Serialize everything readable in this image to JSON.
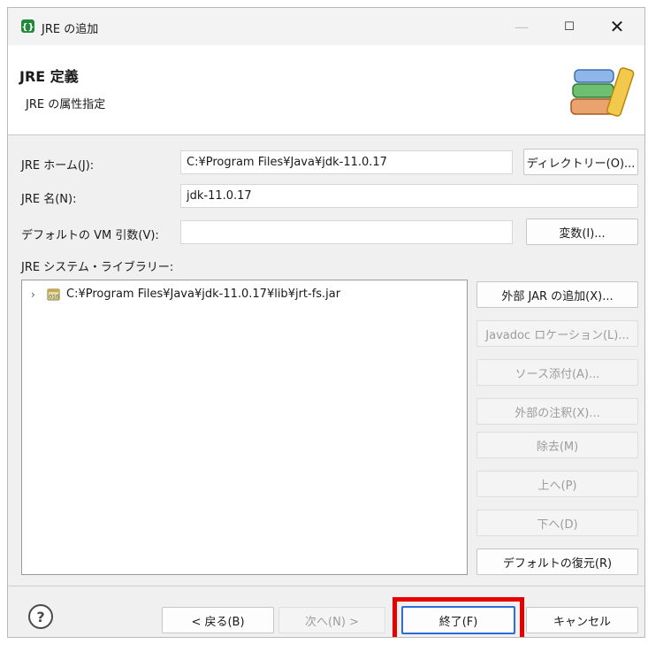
{
  "window": {
    "title": "JRE の追加",
    "min_glyph": "—",
    "max_glyph": "☐",
    "close_glyph": "✕"
  },
  "header": {
    "title": "JRE 定義",
    "subtitle": "JRE の属性指定"
  },
  "form": {
    "jre_home_label": "JRE ホーム(J):",
    "jre_home_value": "C:¥Program Files¥Java¥jdk-11.0.17",
    "directory_button": "ディレクトリー(O)...",
    "jre_name_label": "JRE 名(N):",
    "jre_name_value": "jdk-11.0.17",
    "vm_args_label": "デフォルトの VM 引数(V):",
    "vm_args_value": "",
    "variables_button": "変数(I)...",
    "system_libraries_label": "JRE システム・ライブラリー:"
  },
  "libraries": {
    "items": [
      {
        "label": "C:¥Program Files¥Java¥jdk-11.0.17¥lib¥jrt-fs.jar",
        "expand_glyph": "›"
      }
    ]
  },
  "library_buttons": {
    "add_external_jar": "外部 JAR の追加(X)...",
    "javadoc_location": "Javadoc ロケーション(L)...",
    "source_attachment": "ソース添付(A)...",
    "external_annotations": "外部の注釈(X)...",
    "remove": "除去(M)",
    "up": "上へ(P)",
    "down": "下へ(D)",
    "restore_default": "デフォルトの復元(R)"
  },
  "footer": {
    "help_glyph": "?",
    "back": "< 戻る(B)",
    "next": "次へ(N) >",
    "finish": "終了(F)",
    "cancel": "キャンセル"
  },
  "colors": {
    "highlight": "#e60000",
    "finish_border": "#2b6fd6",
    "disabled_text": "#9c9c9c"
  }
}
